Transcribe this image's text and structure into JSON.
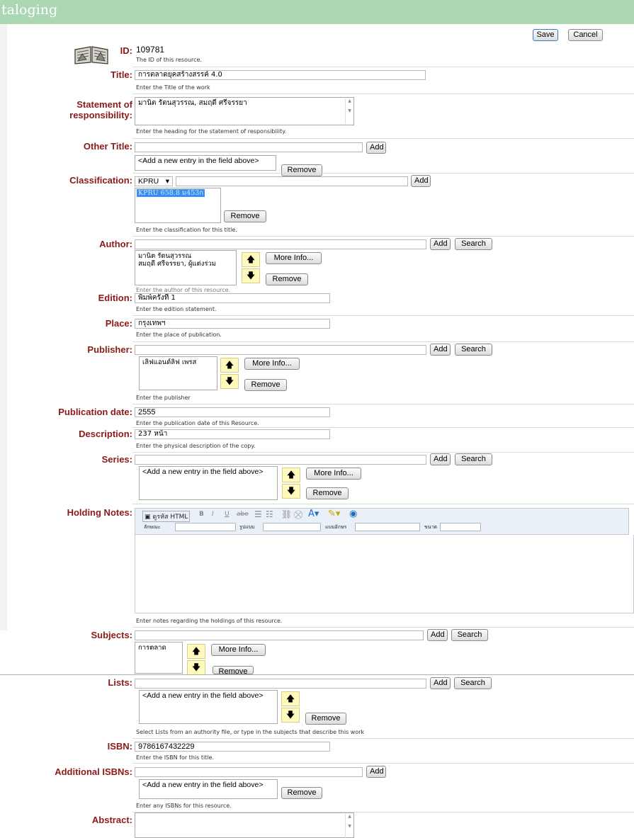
{
  "header": {
    "title": "taloging"
  },
  "toolbar": {
    "save": "Save",
    "cancel": "Cancel"
  },
  "id_row": {
    "label": "ID:",
    "value": "109781",
    "help": "The ID of this resource."
  },
  "title_row": {
    "label": "Title:",
    "value": "การตลาดยุคสร้างสรรค์ 4.0",
    "help": "Enter the Title of the work"
  },
  "statement_row": {
    "label_line1": "Statement of",
    "label_line2": "responsibility:",
    "value": "มานิต รัตนสุวรรณ, สมฤดี ศรีจรรยา",
    "help": "Enter the heading for the statement of responsibility."
  },
  "other_title_row": {
    "label": "Other Title:",
    "add": "Add",
    "list_placeholder": "<Add a new entry in the field above>",
    "remove": "Remove"
  },
  "classification_row": {
    "label": "Classification:",
    "scheme": "KPRU",
    "add": "Add",
    "selected_item": "KPRU 658.8 ม453ก",
    "remove": "Remove",
    "help": "Enter the classification for this title."
  },
  "author_row": {
    "label": "Author:",
    "add": "Add",
    "search": "Search",
    "items": [
      "มานิต รัตนสุวรรณ",
      "สมฤดี ศรีจรรยา, ผู้แต่งร่วม"
    ],
    "more_info": "More Info...",
    "remove": "Remove",
    "help": "Enter the author of this resource."
  },
  "edition_row": {
    "label": "Edition:",
    "value": "พิมพ์ครั้งที่ 1",
    "help": "Enter the edition statement."
  },
  "place_row": {
    "label": "Place:",
    "value": "กรุงเทพฯ",
    "help": "Enter the place of publication."
  },
  "publisher_row": {
    "label": "Publisher:",
    "add": "Add",
    "search": "Search",
    "item": "เลิฟแอนด์ลิฟ เพรส",
    "more_info": "More Info...",
    "remove": "Remove",
    "help": "Enter the publisher"
  },
  "pubdate_row": {
    "label": "Publication date:",
    "value": "2555",
    "help": "Enter the publication date of this Resource."
  },
  "description_row": {
    "label": "Description:",
    "value": "237 หน้า",
    "help": "Enter the physical description of the copy."
  },
  "series_row": {
    "label": "Series:",
    "add": "Add",
    "search": "Search",
    "list_placeholder": "<Add a new entry in the field above>",
    "more_info": "More Info...",
    "remove": "Remove"
  },
  "holding_row": {
    "label": "Holding Notes:",
    "help": "Enter notes regarding the holdings of this resource.",
    "toolbar": {
      "source": "ดูรหัส HTML",
      "bold": "B",
      "italic": "I",
      "underline": "U",
      "strike": "abe",
      "style_label": "ลักษณะ",
      "format_label": "รูปแบบ",
      "font_label": "แบบอักษร",
      "size_label": "ขนาด"
    }
  },
  "subjects_row": {
    "label": "Subjects:",
    "add": "Add",
    "search": "Search",
    "item": "การตลาด",
    "more_info": "More Info...",
    "remove": "Remove"
  },
  "lists_row": {
    "label": "Lists:",
    "add": "Add",
    "search": "Search",
    "list_placeholder": "<Add a new entry in the field above>",
    "remove": "Remove",
    "help": "Select Lists from an authority file, or type in the subjects that describe this work"
  },
  "isbn_row": {
    "label": "ISBN:",
    "value": "9786167432229",
    "help": "Enter the ISBN for this title."
  },
  "additional_isbn_row": {
    "label": "Additional ISBNs:",
    "add": "Add",
    "list_placeholder": "<Add a new entry in the field above>",
    "remove": "Remove",
    "help": "Enter any ISBNs for this resource."
  },
  "abstract_row": {
    "label": "Abstract:"
  },
  "glyphs": {
    "up": "🡅",
    "down": "🡇",
    "caret_up": "▲",
    "caret_down": "▼",
    "dropdown": "▾"
  }
}
